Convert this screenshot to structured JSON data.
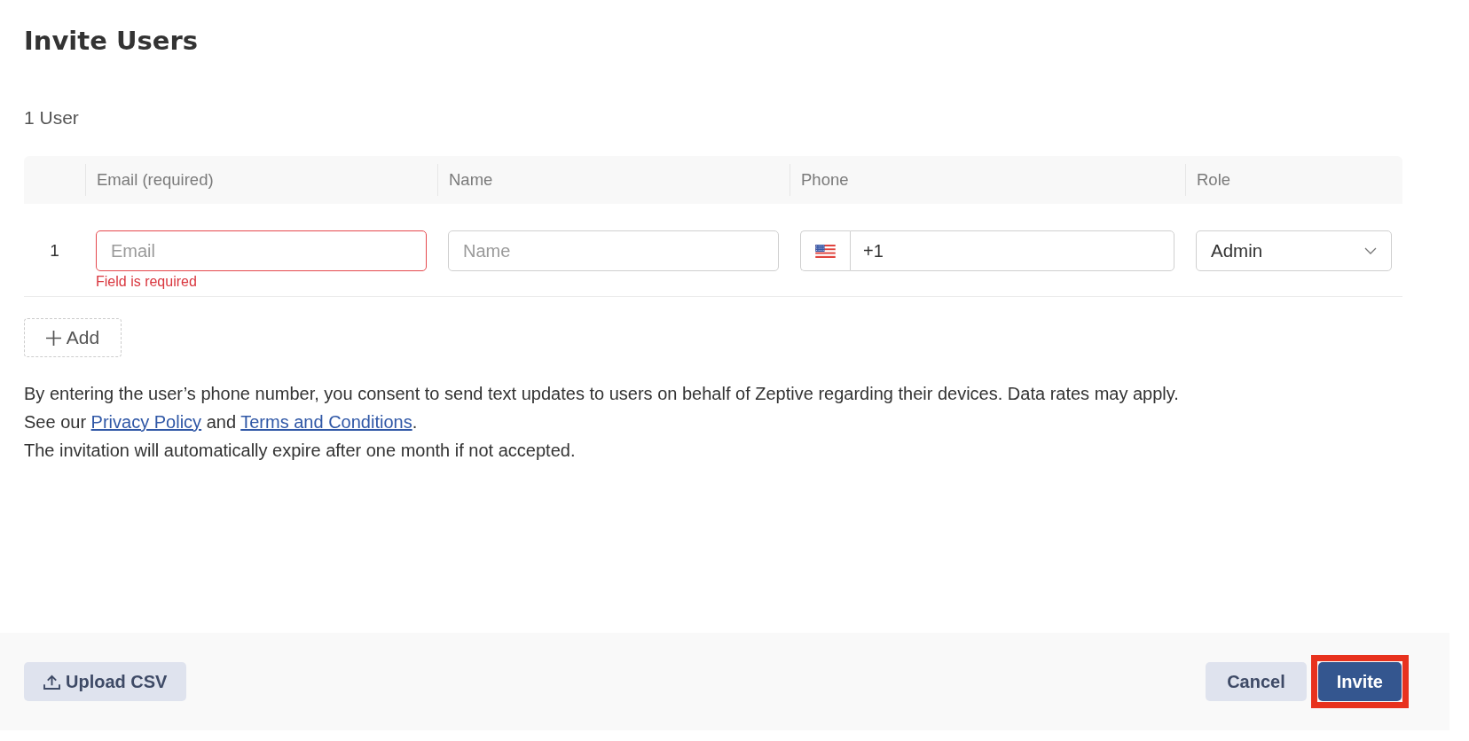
{
  "title": "Invite Users",
  "user_count": "1 User",
  "table": {
    "columns": [
      "Email (required)",
      "Name",
      "Phone",
      "Role"
    ],
    "rows": [
      {
        "number": "1",
        "email": {
          "placeholder": "Email",
          "invalid": true,
          "error": "Field is required"
        },
        "name": {
          "placeholder": "Name",
          "invalid": false
        },
        "phone": {
          "value": "+1"
        },
        "role": {
          "value": "Admin"
        }
      }
    ]
  },
  "add_button": {
    "label": "Add"
  },
  "notes": [
    {
      "kind": "text",
      "text": "By entering the user’s phone number, you consent to send text updates to users on behalf of Zeptive regarding their devices. Data rates may apply."
    },
    {
      "kind": "links",
      "parts": [
        {
          "kind": "text",
          "text": "See our "
        },
        {
          "kind": "link",
          "text": "Privacy Policy"
        },
        {
          "kind": "text",
          "text": " and "
        },
        {
          "kind": "link",
          "text": "Terms and Conditions"
        },
        {
          "kind": "text",
          "text": "."
        }
      ]
    },
    {
      "kind": "text",
      "text": "The invitation will automatically expire after one month if not accepted."
    }
  ],
  "footer": {
    "upload_button": {
      "label": "Upload CSV"
    },
    "buttons": [
      {
        "label": "Cancel",
        "kind": "secondary",
        "highlighted": false
      },
      {
        "label": "Invite",
        "kind": "primary",
        "highlighted": true
      }
    ]
  }
}
